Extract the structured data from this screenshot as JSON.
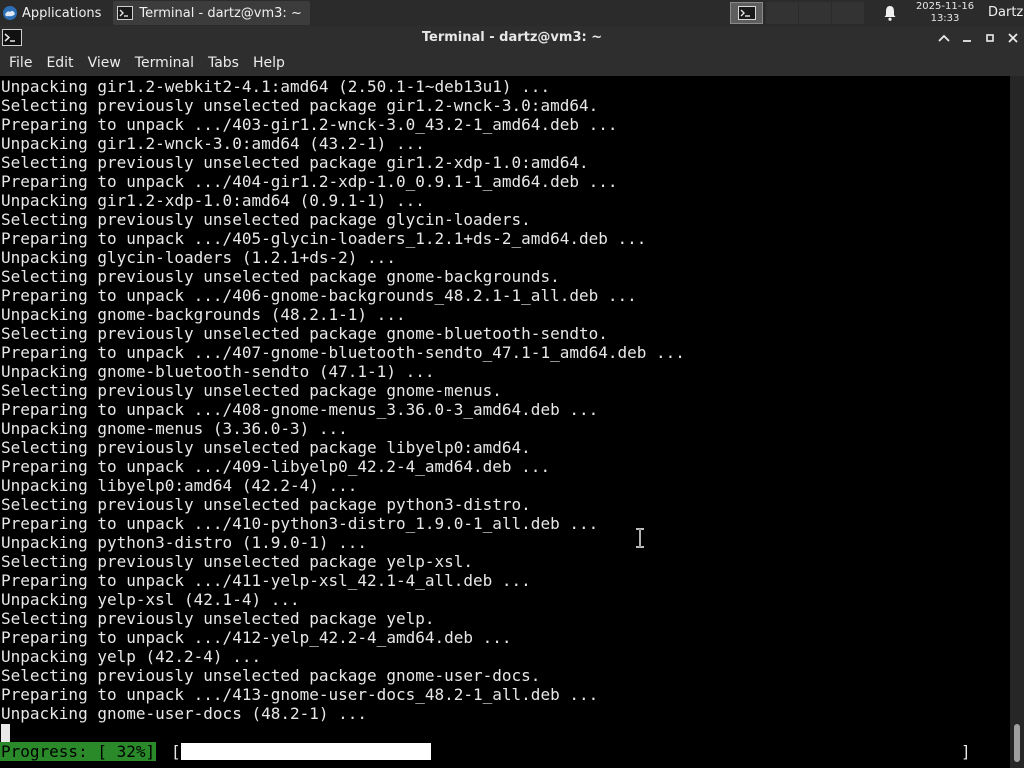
{
  "panel": {
    "applications_label": "Applications",
    "task_label": "Terminal - dartz@vm3: ~",
    "clock_date": "2025-11-16",
    "clock_time": "13:33",
    "user": "Dartz"
  },
  "window": {
    "title": "Terminal - dartz@vm3: ~",
    "minimize_icon": "minimize-icon",
    "maximize_icon": "maximize-icon",
    "close_icon": "close-icon",
    "collapse_icon": "chevron-up-icon"
  },
  "menu": {
    "items": [
      "File",
      "Edit",
      "View",
      "Terminal",
      "Tabs",
      "Help"
    ]
  },
  "terminal": {
    "lines": [
      "Unpacking gir1.2-webkit2-4.1:amd64 (2.50.1-1~deb13u1) ...",
      "Selecting previously unselected package gir1.2-wnck-3.0:amd64.",
      "Preparing to unpack .../403-gir1.2-wnck-3.0_43.2-1_amd64.deb ...",
      "Unpacking gir1.2-wnck-3.0:amd64 (43.2-1) ...",
      "Selecting previously unselected package gir1.2-xdp-1.0:amd64.",
      "Preparing to unpack .../404-gir1.2-xdp-1.0_0.9.1-1_amd64.deb ...",
      "Unpacking gir1.2-xdp-1.0:amd64 (0.9.1-1) ...",
      "Selecting previously unselected package glycin-loaders.",
      "Preparing to unpack .../405-glycin-loaders_1.2.1+ds-2_amd64.deb ...",
      "Unpacking glycin-loaders (1.2.1+ds-2) ...",
      "Selecting previously unselected package gnome-backgrounds.",
      "Preparing to unpack .../406-gnome-backgrounds_48.2.1-1_all.deb ...",
      "Unpacking gnome-backgrounds (48.2.1-1) ...",
      "Selecting previously unselected package gnome-bluetooth-sendto.",
      "Preparing to unpack .../407-gnome-bluetooth-sendto_47.1-1_amd64.deb ...",
      "Unpacking gnome-bluetooth-sendto (47.1-1) ...",
      "Selecting previously unselected package gnome-menus.",
      "Preparing to unpack .../408-gnome-menus_3.36.0-3_amd64.deb ...",
      "Unpacking gnome-menus (3.36.0-3) ...",
      "Selecting previously unselected package libyelp0:amd64.",
      "Preparing to unpack .../409-libyelp0_42.2-4_amd64.deb ...",
      "Unpacking libyelp0:amd64 (42.2-4) ...",
      "Selecting previously unselected package python3-distro.",
      "Preparing to unpack .../410-python3-distro_1.9.0-1_all.deb ...",
      "Unpacking python3-distro (1.9.0-1) ...",
      "Selecting previously unselected package yelp-xsl.",
      "Preparing to unpack .../411-yelp-xsl_42.1-4_all.deb ...",
      "Unpacking yelp-xsl (42.1-4) ...",
      "Selecting previously unselected package yelp.",
      "Preparing to unpack .../412-yelp_42.2-4_amd64.deb ...",
      "Unpacking yelp (42.2-4) ...",
      "Selecting previously unselected package gnome-user-docs.",
      "Preparing to unpack .../413-gnome-user-docs_48.2-1_all.deb ...",
      "Unpacking gnome-user-docs (48.2-1) ..."
    ],
    "progress_label": "Progress: [ 32%]",
    "progress_open": "[",
    "progress_close": "]",
    "progress_fraction": 0.32
  },
  "colors": {
    "panel_bg": "#2b2b2b",
    "terminal_bg": "#000000",
    "terminal_fg": "#e8e8e8",
    "progress_bg": "#2a8a2a"
  }
}
